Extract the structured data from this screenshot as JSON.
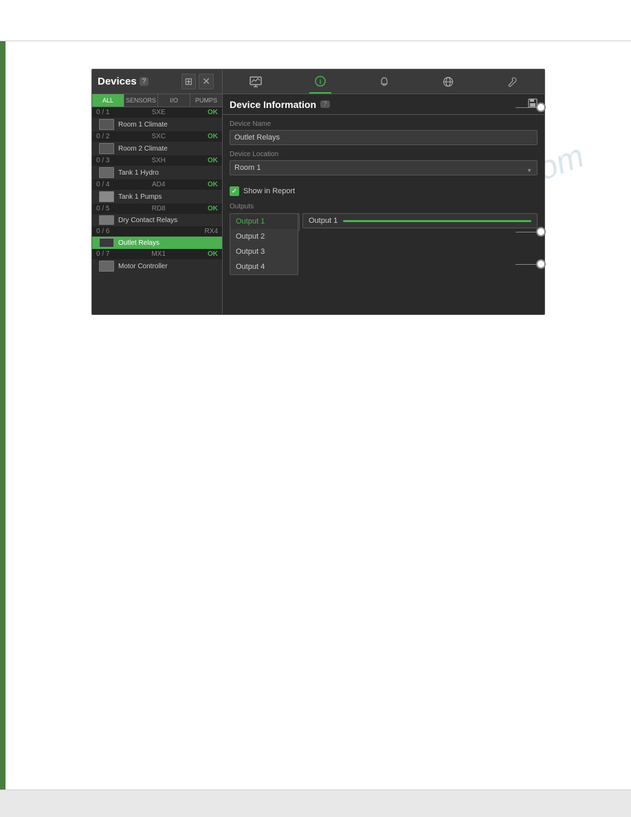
{
  "page": {
    "title": "Devices",
    "watermark": "manualorive.com"
  },
  "toolbar": {
    "devices_label": "Devices",
    "badge": "?",
    "add_icon": "⊞",
    "remove_icon": "✕",
    "filter_tabs": [
      "ALL",
      "SENSORS",
      "I/O",
      "PUMPS"
    ]
  },
  "nav_icons": [
    {
      "name": "monitor",
      "symbol": "⊞",
      "active": false
    },
    {
      "name": "info",
      "symbol": "ℹ",
      "active": true
    },
    {
      "name": "bell",
      "symbol": "🔔",
      "active": false
    },
    {
      "name": "globe",
      "symbol": "⊕",
      "active": false
    },
    {
      "name": "wrench",
      "symbol": "🔧",
      "active": false
    }
  ],
  "devices": [
    {
      "id": "0 / 1",
      "type": "SXE",
      "name": "Room 1 Climate",
      "status": "OK"
    },
    {
      "id": "0 / 2",
      "type": "SXC",
      "name": "Room 2 Climate",
      "status": "OK"
    },
    {
      "id": "0 / 3",
      "type": "SXH",
      "name": "Tank 1 Hydro",
      "status": "OK"
    },
    {
      "id": "0 / 4",
      "type": "AD4",
      "name": "Tank 1 Pumps",
      "status": "OK"
    },
    {
      "id": "0 / 5",
      "type": "RD8",
      "name": "Dry Contact Relays",
      "status": "OK"
    },
    {
      "id": "0 / 6",
      "type": "RX4",
      "name": "Outlet Relays",
      "status": "OK",
      "selected": true
    },
    {
      "id": "0 / 7",
      "type": "MX1",
      "name": "Motor Controller",
      "status": "OK"
    }
  ],
  "panel": {
    "title": "Device Information",
    "help_badge": "?",
    "save_icon": "💾",
    "device_name_label": "Device Name",
    "device_name_value": "Outlet Relays",
    "device_location_label": "Device Location",
    "device_location_value": "Room 1",
    "show_in_report_label": "Show in Report",
    "show_in_report_checked": true,
    "outputs_label": "Outputs",
    "output_selected": "Output 1",
    "output_detail_name": "Output 1",
    "outputs": [
      "Output 1",
      "Output 2",
      "Output 3",
      "Output 4"
    ]
  }
}
